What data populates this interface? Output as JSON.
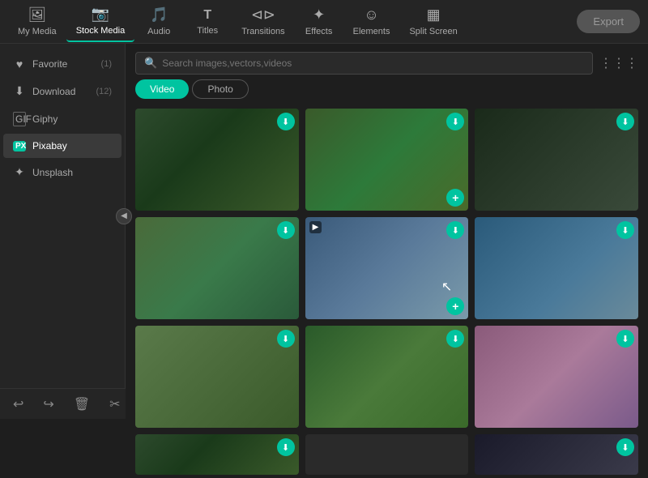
{
  "nav": {
    "items": [
      {
        "id": "my-media",
        "label": "My Media",
        "icon": "🖼",
        "active": false
      },
      {
        "id": "stock-media",
        "label": "Stock Media",
        "icon": "📷",
        "active": true
      },
      {
        "id": "audio",
        "label": "Audio",
        "icon": "🎵",
        "active": false
      },
      {
        "id": "titles",
        "label": "Titles",
        "icon": "T",
        "active": false
      },
      {
        "id": "transitions",
        "label": "Transitions",
        "icon": "⊲⊳",
        "active": false
      },
      {
        "id": "effects",
        "label": "Effects",
        "icon": "✦",
        "active": false
      },
      {
        "id": "elements",
        "label": "Elements",
        "icon": "☺",
        "active": false
      },
      {
        "id": "split-screen",
        "label": "Split Screen",
        "icon": "▦",
        "active": false
      }
    ],
    "export_label": "Export"
  },
  "sidebar": {
    "items": [
      {
        "id": "favorite",
        "label": "Favorite",
        "icon": "♥",
        "count": "(1)",
        "active": false
      },
      {
        "id": "download",
        "label": "Download",
        "icon": "⬇",
        "count": "(12)",
        "active": false
      },
      {
        "id": "giphy",
        "label": "Giphy",
        "icon": "□",
        "count": "",
        "active": false
      },
      {
        "id": "pixabay",
        "label": "Pixabay",
        "icon": "px",
        "count": "",
        "active": true
      },
      {
        "id": "unsplash",
        "label": "Unsplash",
        "icon": "✦",
        "count": "",
        "active": false
      }
    ]
  },
  "search": {
    "placeholder": "Search images,vectors,videos"
  },
  "tabs": [
    {
      "id": "video",
      "label": "Video",
      "active": true
    },
    {
      "id": "photo",
      "label": "Photo",
      "active": false
    }
  ],
  "toolbar": {
    "buttons": [
      "↩",
      "↪",
      "🗑",
      "✂",
      "☰"
    ],
    "help": "?"
  },
  "media_grid": {
    "thumbs": [
      {
        "id": 1,
        "class": "thumb-1",
        "has_download": true,
        "has_add": false,
        "has_video": false
      },
      {
        "id": 2,
        "class": "thumb-2",
        "has_download": true,
        "has_add": true,
        "has_video": false
      },
      {
        "id": 3,
        "class": "thumb-3",
        "has_download": true,
        "has_add": false,
        "has_video": false
      },
      {
        "id": 4,
        "class": "thumb-4",
        "has_download": true,
        "has_add": false,
        "has_video": false
      },
      {
        "id": 5,
        "class": "thumb-5",
        "has_download": true,
        "has_add": true,
        "has_video": true,
        "has_cursor": true
      },
      {
        "id": 6,
        "class": "thumb-6",
        "has_download": true,
        "has_add": false,
        "has_video": false
      },
      {
        "id": 7,
        "class": "thumb-7",
        "has_download": true,
        "has_add": false,
        "has_video": false
      },
      {
        "id": 8,
        "class": "thumb-8",
        "has_download": true,
        "has_add": false,
        "has_video": false
      },
      {
        "id": 9,
        "class": "thumb-9",
        "has_download": true,
        "has_add": false,
        "has_video": false
      },
      {
        "id": 10,
        "class": "thumb-10",
        "has_download": true,
        "has_add": false,
        "has_video": false
      }
    ]
  }
}
